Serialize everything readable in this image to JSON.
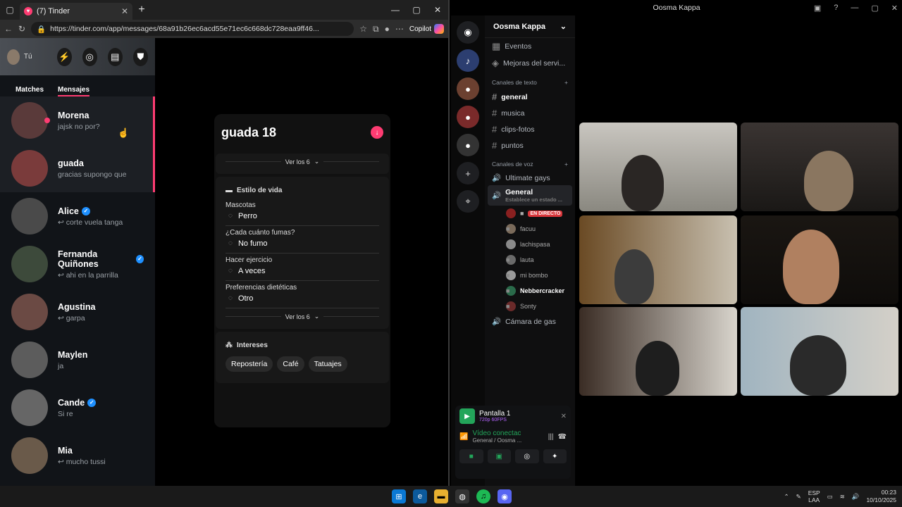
{
  "browser": {
    "tab_title": "(7) Tinder",
    "url": "https://tinder.com/app/messages/68a91b26ec6acd55e71ec6c668dc728eaa9ff46...",
    "copilot": "Copilot"
  },
  "tinder": {
    "profile_label": "Tú",
    "tabs": [
      "Matches",
      "Mensajes"
    ],
    "conversations": [
      {
        "name": "Morena",
        "msg": "jajsk no por?",
        "verified": false,
        "color": "#5a3a3a"
      },
      {
        "name": "guada",
        "msg": "gracias supongo que",
        "verified": false,
        "color": "#7a3b3b"
      },
      {
        "name": "Alice",
        "msg": "↩ corte vuela tanga",
        "verified": true,
        "color": "#4a4a4a"
      },
      {
        "name": "Fernanda Quiñones",
        "msg": "↩ ahi en la parrilla",
        "verified": true,
        "color": "#3d4a3b"
      },
      {
        "name": "Agustina",
        "msg": "↩ garpa",
        "verified": false,
        "color": "#6b4a44"
      },
      {
        "name": "Maylen",
        "msg": "ja",
        "verified": false,
        "color": "#5c5c5c"
      },
      {
        "name": "Cande",
        "msg": "Si re",
        "verified": true,
        "color": "#666"
      },
      {
        "name": "Mia",
        "msg": "↩ mucho tussi",
        "verified": false,
        "color": "#6a5a4a"
      }
    ],
    "card": {
      "name": "guada 18",
      "ver_mas": "Ver los 6",
      "lifestyle_title": "Estilo de vida",
      "rows": [
        {
          "label": "Mascotas",
          "value": "Perro",
          "icon": "paw-icon"
        },
        {
          "label": "¿Cada cuánto fumas?",
          "value": "No fumo",
          "icon": "smoke-icon"
        },
        {
          "label": "Hacer ejercicio",
          "value": "A veces",
          "icon": "dumbbell-icon"
        },
        {
          "label": "Preferencias dietéticas",
          "value": "Otro",
          "icon": "utensils-icon"
        }
      ],
      "interests_title": "Intereses",
      "interests": [
        "Repostería",
        "Café",
        "Tatuajes"
      ]
    }
  },
  "discord": {
    "window_title": "Oosma Kappa",
    "server_name": "Oosma Kappa",
    "top_items": [
      "Eventos",
      "Mejoras del servi..."
    ],
    "text_category": "Canales de texto",
    "text_channels": [
      "general",
      "musica",
      "clips-fotos",
      "puntos"
    ],
    "voice_category": "Canales de voz",
    "voice_channels": [
      "Ultimate gays",
      "General",
      "Cámara de gas"
    ],
    "general_status": "Establece un estado ...",
    "live_label": "EN DIRECTO",
    "voice_users": [
      "facuu",
      "lachispasa",
      "lauta",
      "mi bombo",
      "Nebbercracker",
      "Sonty"
    ],
    "screen_share": {
      "title": "Pantalla 1",
      "sub": "720p 60FPS"
    },
    "connection": {
      "status": "Vídeo conectac",
      "channel": "General / Oosma ..."
    }
  },
  "taskbar": {
    "lang": "ESP",
    "lang2": "LAA",
    "time": "00:23",
    "date": "10/10/2025"
  }
}
